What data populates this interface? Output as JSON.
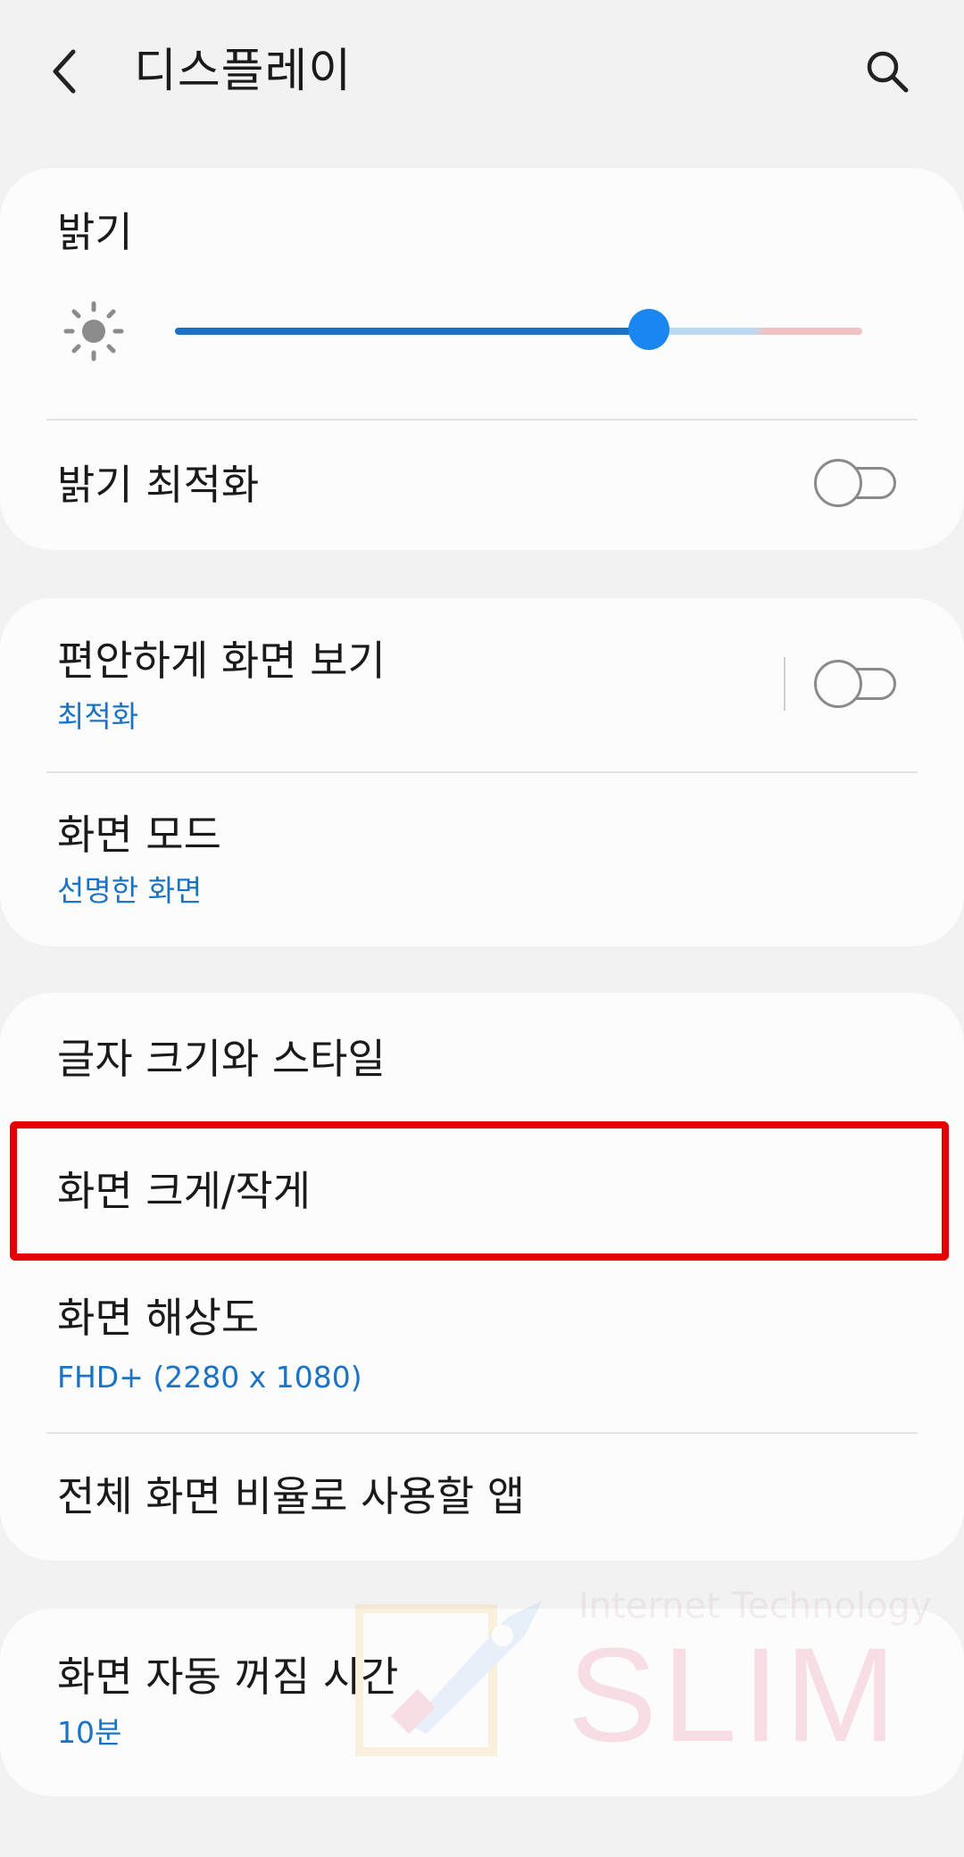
{
  "header": {
    "title": "디스플레이"
  },
  "brightness": {
    "title": "밝기",
    "level": 0.69,
    "adaptive_label": "밝기 최적화",
    "adaptive_on": false
  },
  "eye_comfort": {
    "title": "편안하게 화면 보기",
    "subtitle": "최적화",
    "on": false
  },
  "screen_mode": {
    "title": "화면 모드",
    "subtitle": "선명한 화면"
  },
  "font_style": {
    "title": "글자 크기와 스타일"
  },
  "screen_zoom": {
    "title": "화면 크게/작게"
  },
  "resolution": {
    "title": "화면 해상도",
    "subtitle": "FHD+ (2280 x 1080)"
  },
  "full_screen_apps": {
    "title": "전체 화면 비율로 사용할 앱"
  },
  "screen_timeout": {
    "title": "화면 자동 꺼짐 시간",
    "subtitle": "10분"
  },
  "watermark": {
    "line1": "Internet Technology",
    "line2": "SLIM"
  },
  "colors": {
    "accent": "#1a86f0",
    "subtitle_blue": "#1a73c4",
    "highlight_red": "#e60000"
  }
}
